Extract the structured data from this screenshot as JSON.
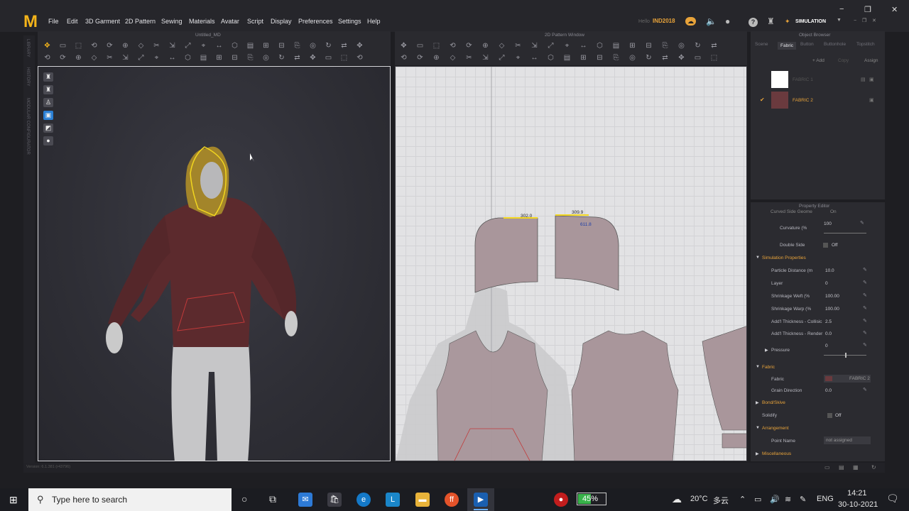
{
  "menubar": {
    "logo": "M",
    "items": [
      "File",
      "Edit",
      "3D Garment",
      "2D Pattern",
      "Sewing",
      "Materials",
      "Avatar",
      "Script",
      "Display",
      "Preferences",
      "Settings",
      "Help"
    ],
    "user_greeting": "Hello",
    "username": "IND2018",
    "mode_label": "SIMULATION",
    "win_minimize": "−",
    "win_maximize": "❐",
    "win_close": "✕"
  },
  "window_titles": {
    "view3d": "Untitled_MD",
    "view2d": "2D Pattern Window",
    "object_browser": "Object Browser",
    "property_editor": "Property Editor"
  },
  "left_sidebar": [
    "LIBRARY",
    "HISTORY",
    "MODULAR CONFIGURATOR"
  ],
  "version": "Version: 6.1.381 (r43796)",
  "pattern_labels": {
    "segment_a": "302.0",
    "segment_b": "309.9",
    "segment_total": "611.8"
  },
  "object_browser": {
    "tabs": [
      "Scene",
      "Fabric",
      "Button",
      "Buttonhole",
      "Topstitch"
    ],
    "active_tab": "Fabric",
    "add_label": "+ Add",
    "copy_label": "Copy",
    "assign_label": "Assign",
    "fabrics": [
      {
        "name": "FABRIC 1",
        "color": "#ffffff",
        "selected": false
      },
      {
        "name": "FABRIC 2",
        "color": "#6a3a3e",
        "selected": true
      }
    ]
  },
  "property_editor": {
    "partial_row": "Curved Side Geome",
    "partial_val": "On",
    "curvature_label": "Curvature (%",
    "curvature_value": "100",
    "double_side_label": "Double Side",
    "double_side_value": "Off",
    "sim_section": "Simulation Properties",
    "sim_rows": [
      {
        "label": "Particle Distance (m",
        "value": "10.0"
      },
      {
        "label": "Layer",
        "value": "0"
      },
      {
        "label": "Shrinkage Weft (%",
        "value": "100.00"
      },
      {
        "label": "Shrinkage Warp (%",
        "value": "100.00"
      },
      {
        "label": "Add'l Thickness - Collisic",
        "value": "2.5"
      },
      {
        "label": "Add'l Thickness - Render",
        "value": "0.0"
      }
    ],
    "pressure_label": "Pressure",
    "pressure_value": "0",
    "fabric_section": "Fabric",
    "fabric_label": "Fabric",
    "fabric_value": "FABRIC 2",
    "grain_label": "Grain Direction",
    "grain_value": "0.0",
    "bond_section": "Bond/Skive",
    "solidify_label": "Solidify",
    "solidify_value": "Off",
    "arrangement_section": "Arrangement",
    "point_name_label": "Point Name",
    "point_name_value": "not assigned",
    "misc_section": "Miscellaneous"
  },
  "taskbar": {
    "search_placeholder": "Type here to search",
    "battery": "45%",
    "weather_temp": "20°C",
    "weather_desc": "多云",
    "lang": "ENG",
    "time": "14:21",
    "date": "30-10-2021"
  }
}
